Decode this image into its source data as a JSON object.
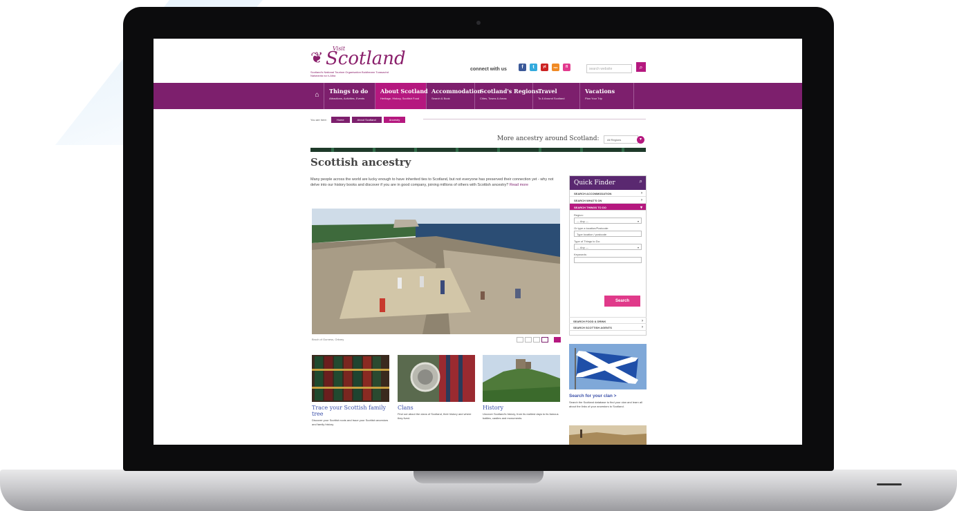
{
  "brand": {
    "visit": "Visit",
    "name": "Scotland",
    "tagline": "Scotland's National Tourism Organisation Buidheann Turasachd Naiseanta na h-Alba"
  },
  "header": {
    "connect_label": "connect with us",
    "socials": [
      "f",
      "t",
      "yt",
      "rss",
      "fl"
    ],
    "search_placeholder": "search website"
  },
  "nav": {
    "home_icon": "home-icon",
    "items": [
      {
        "title": "Things to do",
        "sub": "Attractions, Activities, Events"
      },
      {
        "title": "About Scotland",
        "sub": "Heritage, History, Scottish Food"
      },
      {
        "title": "Accommodation",
        "sub": "Search & Book"
      },
      {
        "title": "Scotland's Regions",
        "sub": "Cities, Towns & Areas"
      },
      {
        "title": "Travel",
        "sub": "To & Around Scotland"
      },
      {
        "title": "Vacations",
        "sub": "Plan Your Trip"
      }
    ]
  },
  "breadcrumb": {
    "lead": "You are here:",
    "items": [
      "Home",
      "About Scotland",
      "Ancestry"
    ]
  },
  "more_ancestry": {
    "label": "More ancestry around Scotland:",
    "select_value": "All Regions"
  },
  "page": {
    "title": "Scottish ancestry",
    "intro": "Many people across the world are lucky enough to have inherited ties to Scotland, but not everyone has preserved their connection yet - why not delve into our history books and discover if you are in good company, joining millions of others with Scottish ancestry?",
    "intro_link": "Read more",
    "hero_caption": "Broch of Gurness, Orkney"
  },
  "cards": [
    {
      "title": "Trace your Scottish family tree",
      "text": "Discover your Scottish roots and trace your Scottish ancestors and family history."
    },
    {
      "title": "Clans",
      "text": "Find out about the clans of Scotland, their history and where they lived."
    },
    {
      "title": "History",
      "text": "Uncover Scotland's history, from its earliest days to its famous battles, castles and monuments."
    }
  ],
  "quick_finder": {
    "title": "Quick Finder",
    "rows_top": [
      "SEARCH ACCOMMODATION",
      "SEARCH WHAT'S ON",
      "SEARCH THINGS TO DO"
    ],
    "region_label": "Region:",
    "region_value": "--- Any ---",
    "location_label": "Or type a location/Postcode:",
    "location_value": "Type location / postcode",
    "type_label": "Type of Things to Do:",
    "type_value": "--- Any ---",
    "keywords_label": "Keywords:",
    "submit_label": "Search",
    "rows_bottom": [
      "SEARCH FOOD & DRINK",
      "SEARCH SCOTTISH AGENTS"
    ]
  },
  "sidebar": {
    "link": "Search for your clan >",
    "text": "Search the Scotland database to find your clan and learn all about the links of your ancestors to Scotland."
  },
  "colors": {
    "nav": "#7d1f6d",
    "accent": "#b5187f",
    "link": "#3a4fa8",
    "quick_finder_head": "#5a2870"
  }
}
